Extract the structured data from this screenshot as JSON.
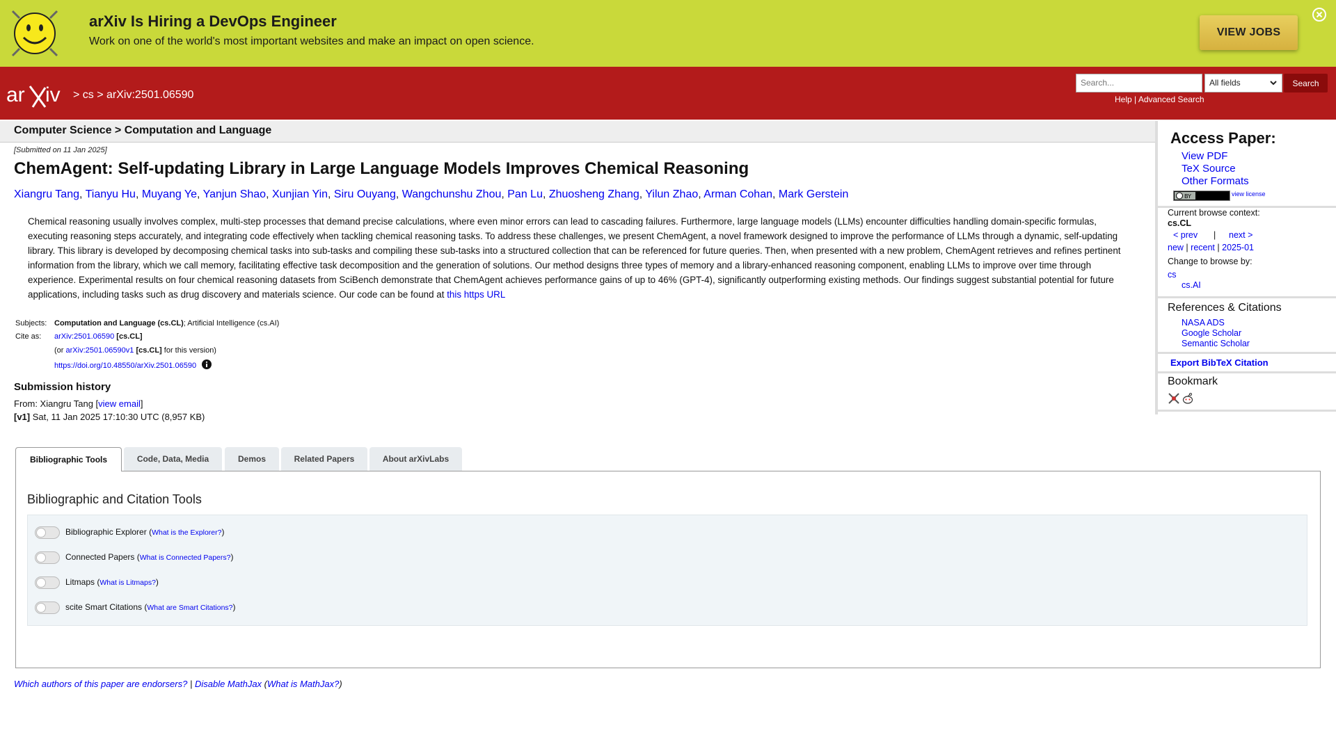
{
  "banner": {
    "title": "arXiv Is Hiring a DevOps Engineer",
    "subtitle": "Work on one of the world's most important websites and make an impact on open science.",
    "cta_label": "VIEW JOBS"
  },
  "header": {
    "breadcrumb": "> cs > arXiv:2501.06590",
    "search_placeholder": "Search...",
    "search_field_value": "All fields",
    "search_button": "Search",
    "help_label": "Help",
    "sep": "|",
    "advanced_label": "Advanced Search"
  },
  "subheader": {
    "title": "Computer Science > Computation and Language"
  },
  "paper": {
    "submitted": "[Submitted on 11 Jan 2025]",
    "title": "ChemAgent: Self-updating Library in Large Language Models Improves Chemical Reasoning",
    "authors": [
      "Xiangru Tang",
      "Tianyu Hu",
      "Muyang Ye",
      "Yanjun Shao",
      "Xunjian Yin",
      "Siru Ouyang",
      "Wangchunshu Zhou",
      "Pan Lu",
      "Zhuosheng Zhang",
      "Yilun Zhao",
      "Arman Cohan",
      "Mark Gerstein"
    ],
    "abstract": "Chemical reasoning usually involves complex, multi-step processes that demand precise calculations, where even minor errors can lead to cascading failures. Furthermore, large language models (LLMs) encounter difficulties handling domain-specific formulas, executing reasoning steps accurately, and integrating code effectively when tackling chemical reasoning tasks. To address these challenges, we present ChemAgent, a novel framework designed to improve the performance of LLMs through a dynamic, self-updating library. This library is developed by decomposing chemical tasks into sub-tasks and compiling these sub-tasks into a structured collection that can be referenced for future queries. Then, when presented with a new problem, ChemAgent retrieves and refines pertinent information from the library, which we call memory, facilitating effective task decomposition and the generation of solutions. Our method designs three types of memory and a library-enhanced reasoning component, enabling LLMs to improve over time through experience. Experimental results on four chemical reasoning datasets from SciBench demonstrate that ChemAgent achieves performance gains of up to 46% (GPT-4), significantly outperforming existing methods. Our findings suggest substantial potential for future applications, including tasks such as drug discovery and materials science. Our code can be found at",
    "abstract_link": "this https URL",
    "subjects_label": "Subjects:",
    "subjects_primary": "Computation and Language (cs.CL)",
    "subjects_rest": "; Artificial Intelligence (cs.AI)",
    "cite_label": "Cite as:",
    "cite_id": "arXiv:2501.06590",
    "cite_cat": "[cs.CL]",
    "or_prefix": "(or",
    "cite_version": "arXiv:2501.06590v1",
    "cite_version_suffix": "for this version)",
    "doi": "https://doi.org/10.48550/arXiv.2501.06590"
  },
  "history": {
    "heading": "Submission history",
    "from_prefix": "From: Xiangru Tang [",
    "view_email": "view email",
    "from_suffix": "]",
    "v1_label": "[v1]",
    "v1_text": "Sat, 11 Jan 2025 17:10:30 UTC (8,957 KB)"
  },
  "sidebar": {
    "access_heading": "Access Paper:",
    "access_links": [
      "View PDF",
      "TeX Source",
      "Other Formats"
    ],
    "view_license": "view license",
    "context_label": "Current browse context:",
    "context_value": "cs.CL",
    "prev": "< prev",
    "pipe": "|",
    "next": "next >",
    "new": "new",
    "recent": "recent",
    "month": "2025-01",
    "change_label": "Change to browse by:",
    "browse_cs": "cs",
    "browse_csai": "cs.AI",
    "refs_heading": "References & Citations",
    "refs": [
      "NASA ADS",
      "Google Scholar",
      "Semantic Scholar"
    ],
    "bibtex": "Export BibTeX Citation",
    "bookmark_heading": "Bookmark"
  },
  "tabs": [
    "Bibliographic Tools",
    "Code, Data, Media",
    "Demos",
    "Related Papers",
    "About arXivLabs"
  ],
  "tools": {
    "heading": "Bibliographic and Citation Tools",
    "items": [
      {
        "label": "Bibliographic Explorer",
        "link": "What is the Explorer?"
      },
      {
        "label": "Connected Papers",
        "link": "What is Connected Papers?"
      },
      {
        "label": "Litmaps",
        "link": "What is Litmaps?"
      },
      {
        "label": "scite Smart Citations",
        "link": "What are Smart Citations?"
      }
    ]
  },
  "footer": {
    "endorsers": "Which authors of this paper are endorsers?",
    "sep": "|",
    "disable_mathjax": "Disable MathJax",
    "what_mathjax": "What is MathJax?"
  }
}
